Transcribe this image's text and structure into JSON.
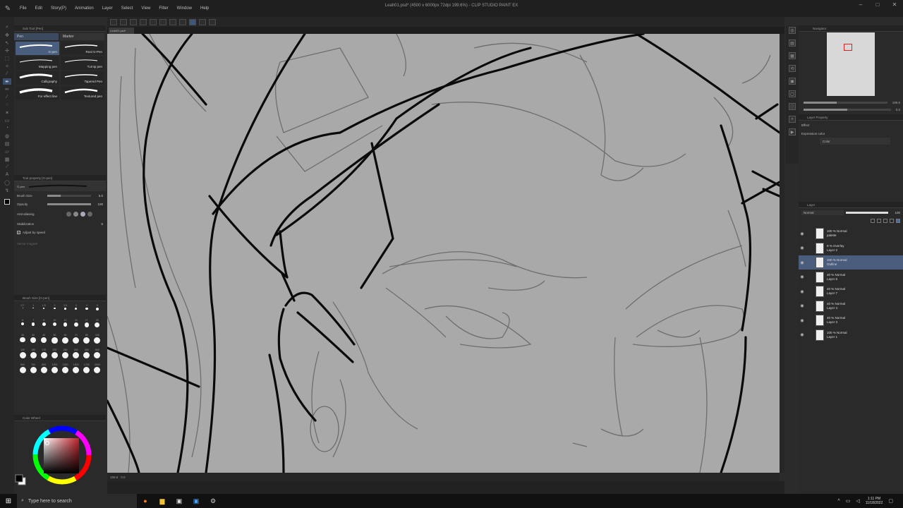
{
  "menubar": {
    "items": [
      "File",
      "Edit",
      "Story(P)",
      "Animation",
      "Layer",
      "Select",
      "View",
      "Filter",
      "Window",
      "Help"
    ],
    "title": "Leah01.psd* (4500 x 6000px 72dpi 199.6%) - CLIP STUDIO PAINT EX"
  },
  "document_tab": {
    "label": "Leah01.psd*"
  },
  "sub_tool": {
    "panel_title": "Sub Tool [Pen]",
    "tabs": [
      "Pen",
      "Marker"
    ],
    "brushes": [
      "G-pen",
      "Real G-Pen",
      "Mapping pen",
      "Turnip pen",
      "Calligraphy",
      "Tapered Pen",
      "For effect line",
      "Textured pen"
    ]
  },
  "tool_property": {
    "panel_title": "Tool property [G-pen]",
    "preset_label": "G-pen",
    "brush_size_label": "Brush Size",
    "brush_size_value": "5.0",
    "opacity_label": "Opacity",
    "opacity_value": "100",
    "anti_aliasing_label": "Anti-aliasing",
    "stabilization_label": "Stabilization",
    "stabilization_value": "5",
    "adjust_by_speed_label": "Adjust by speed",
    "vector_magnet_label": "Vector magnet"
  },
  "brush_size_panel": {
    "panel_title": "Brush Size [G-pen]",
    "sizes": [
      "0.7",
      "1",
      "1.5",
      "2",
      "2.5",
      "3",
      "4",
      "5",
      "6",
      "7",
      "8",
      "10",
      "12",
      "15",
      "17",
      "20",
      "25",
      "30",
      "40",
      "50",
      "60",
      "70",
      "80",
      "100",
      "120",
      "150",
      "170",
      "200",
      "250",
      "300",
      "400",
      "500",
      "600",
      "700",
      "800",
      "1000",
      "1200",
      "1500",
      "1700",
      "2000"
    ]
  },
  "color_wheel": {
    "panel_title": "Color Wheel",
    "main_color": "#000000",
    "sub_color": "#ffffff",
    "square_hue": "#c0222a"
  },
  "navigator": {
    "panel_title": "Navigator",
    "zoom": "199.6",
    "angle": "0.0"
  },
  "layer_property": {
    "panel_title": "Layer Property",
    "effect_label": "Effect",
    "expression_color_label": "Expression color",
    "expression_color_value": "Color"
  },
  "layer_panel": {
    "panel_title": "Layer",
    "blend_mode": "Normal",
    "opacity": "100",
    "layers": [
      {
        "mode": "100 % Normal",
        "name": "palette",
        "selected": false
      },
      {
        "mode": "9 % Overlay",
        "name": "Layer 2",
        "selected": false
      },
      {
        "mode": "100 % Normal",
        "name": "Outline",
        "selected": true
      },
      {
        "mode": "40 % Normal",
        "name": "Layer 6",
        "selected": false
      },
      {
        "mode": "40 % Normal",
        "name": "Layer 7",
        "selected": false
      },
      {
        "mode": "40 % Normal",
        "name": "Layer 4",
        "selected": false
      },
      {
        "mode": "40 % Normal",
        "name": "Layer 3",
        "selected": false
      },
      {
        "mode": "100 % Normal",
        "name": "Layer 1",
        "selected": false
      }
    ]
  },
  "canvas_status": {
    "zoom": "199.6",
    "angle": "0.0"
  },
  "taskbar": {
    "search_placeholder": "Type here to search",
    "time": "1:11 PM",
    "date": "11/18/2022"
  },
  "colors": {
    "accent": "#4b5d7d",
    "canvas_bg": "#a9a9a9",
    "line": "#0a0a0a",
    "sketch": "#6e6e6e"
  }
}
